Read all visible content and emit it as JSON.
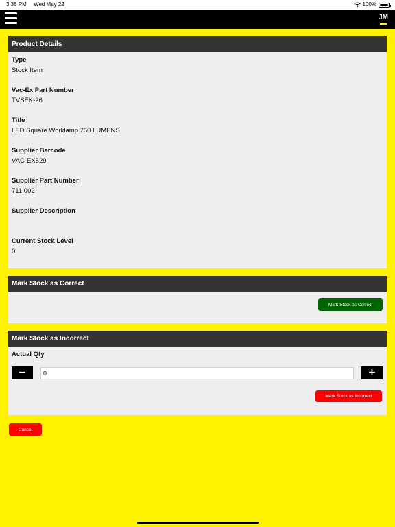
{
  "status_bar": {
    "time": "3:36 PM",
    "date": "Wed May 22",
    "battery": "100%",
    "wifi_icon": "wifi-icon",
    "battery_icon": "battery-icon"
  },
  "nav": {
    "menu_icon": "hamburger-menu-icon",
    "logo_text": "JM"
  },
  "product_details": {
    "header": "Product Details",
    "fields": [
      {
        "label": "Type",
        "value": "Stock Item"
      },
      {
        "label": "Vac-Ex Part Number",
        "value": "TVSEK-26"
      },
      {
        "label": "Title",
        "value": "LED Square Worklamp 750 LUMENS"
      },
      {
        "label": "Supplier Barcode",
        "value": "VAC-EX529"
      },
      {
        "label": "Supplier Part Number",
        "value": "711.002"
      },
      {
        "label": "Supplier Description",
        "value": ""
      },
      {
        "label": "Current Stock Level",
        "value": "0"
      }
    ]
  },
  "mark_correct": {
    "header": "Mark Stock as Correct",
    "button_label": "Mark Stock as Correct"
  },
  "mark_incorrect": {
    "header": "Mark Stock as Incorrect",
    "qty_label": "Actual Qty",
    "qty_value": "0",
    "minus_label": "−",
    "plus_label": "+",
    "button_label": "Mark Stock as Incorrect"
  },
  "cancel_label": "Cancel",
  "colors": {
    "background": "#FFF200",
    "header": "#333333",
    "card": "#EEEEEE",
    "correct_button": "#006400",
    "incorrect_button": "#FF0000"
  }
}
